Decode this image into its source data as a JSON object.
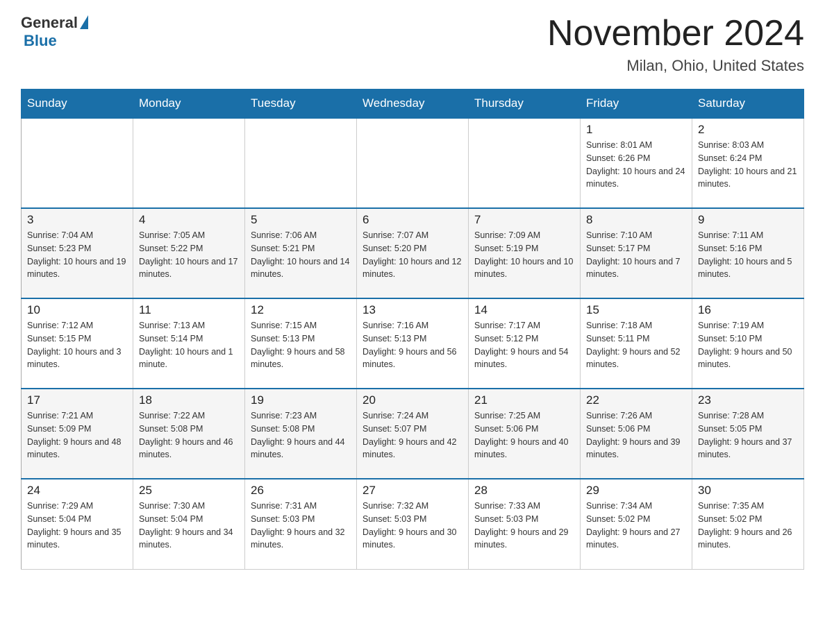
{
  "logo": {
    "general": "General",
    "blue": "Blue"
  },
  "title": "November 2024",
  "location": "Milan, Ohio, United States",
  "weekdays": [
    "Sunday",
    "Monday",
    "Tuesday",
    "Wednesday",
    "Thursday",
    "Friday",
    "Saturday"
  ],
  "weeks": [
    [
      {
        "day": "",
        "info": ""
      },
      {
        "day": "",
        "info": ""
      },
      {
        "day": "",
        "info": ""
      },
      {
        "day": "",
        "info": ""
      },
      {
        "day": "",
        "info": ""
      },
      {
        "day": "1",
        "info": "Sunrise: 8:01 AM\nSunset: 6:26 PM\nDaylight: 10 hours and 24 minutes."
      },
      {
        "day": "2",
        "info": "Sunrise: 8:03 AM\nSunset: 6:24 PM\nDaylight: 10 hours and 21 minutes."
      }
    ],
    [
      {
        "day": "3",
        "info": "Sunrise: 7:04 AM\nSunset: 5:23 PM\nDaylight: 10 hours and 19 minutes."
      },
      {
        "day": "4",
        "info": "Sunrise: 7:05 AM\nSunset: 5:22 PM\nDaylight: 10 hours and 17 minutes."
      },
      {
        "day": "5",
        "info": "Sunrise: 7:06 AM\nSunset: 5:21 PM\nDaylight: 10 hours and 14 minutes."
      },
      {
        "day": "6",
        "info": "Sunrise: 7:07 AM\nSunset: 5:20 PM\nDaylight: 10 hours and 12 minutes."
      },
      {
        "day": "7",
        "info": "Sunrise: 7:09 AM\nSunset: 5:19 PM\nDaylight: 10 hours and 10 minutes."
      },
      {
        "day": "8",
        "info": "Sunrise: 7:10 AM\nSunset: 5:17 PM\nDaylight: 10 hours and 7 minutes."
      },
      {
        "day": "9",
        "info": "Sunrise: 7:11 AM\nSunset: 5:16 PM\nDaylight: 10 hours and 5 minutes."
      }
    ],
    [
      {
        "day": "10",
        "info": "Sunrise: 7:12 AM\nSunset: 5:15 PM\nDaylight: 10 hours and 3 minutes."
      },
      {
        "day": "11",
        "info": "Sunrise: 7:13 AM\nSunset: 5:14 PM\nDaylight: 10 hours and 1 minute."
      },
      {
        "day": "12",
        "info": "Sunrise: 7:15 AM\nSunset: 5:13 PM\nDaylight: 9 hours and 58 minutes."
      },
      {
        "day": "13",
        "info": "Sunrise: 7:16 AM\nSunset: 5:13 PM\nDaylight: 9 hours and 56 minutes."
      },
      {
        "day": "14",
        "info": "Sunrise: 7:17 AM\nSunset: 5:12 PM\nDaylight: 9 hours and 54 minutes."
      },
      {
        "day": "15",
        "info": "Sunrise: 7:18 AM\nSunset: 5:11 PM\nDaylight: 9 hours and 52 minutes."
      },
      {
        "day": "16",
        "info": "Sunrise: 7:19 AM\nSunset: 5:10 PM\nDaylight: 9 hours and 50 minutes."
      }
    ],
    [
      {
        "day": "17",
        "info": "Sunrise: 7:21 AM\nSunset: 5:09 PM\nDaylight: 9 hours and 48 minutes."
      },
      {
        "day": "18",
        "info": "Sunrise: 7:22 AM\nSunset: 5:08 PM\nDaylight: 9 hours and 46 minutes."
      },
      {
        "day": "19",
        "info": "Sunrise: 7:23 AM\nSunset: 5:08 PM\nDaylight: 9 hours and 44 minutes."
      },
      {
        "day": "20",
        "info": "Sunrise: 7:24 AM\nSunset: 5:07 PM\nDaylight: 9 hours and 42 minutes."
      },
      {
        "day": "21",
        "info": "Sunrise: 7:25 AM\nSunset: 5:06 PM\nDaylight: 9 hours and 40 minutes."
      },
      {
        "day": "22",
        "info": "Sunrise: 7:26 AM\nSunset: 5:06 PM\nDaylight: 9 hours and 39 minutes."
      },
      {
        "day": "23",
        "info": "Sunrise: 7:28 AM\nSunset: 5:05 PM\nDaylight: 9 hours and 37 minutes."
      }
    ],
    [
      {
        "day": "24",
        "info": "Sunrise: 7:29 AM\nSunset: 5:04 PM\nDaylight: 9 hours and 35 minutes."
      },
      {
        "day": "25",
        "info": "Sunrise: 7:30 AM\nSunset: 5:04 PM\nDaylight: 9 hours and 34 minutes."
      },
      {
        "day": "26",
        "info": "Sunrise: 7:31 AM\nSunset: 5:03 PM\nDaylight: 9 hours and 32 minutes."
      },
      {
        "day": "27",
        "info": "Sunrise: 7:32 AM\nSunset: 5:03 PM\nDaylight: 9 hours and 30 minutes."
      },
      {
        "day": "28",
        "info": "Sunrise: 7:33 AM\nSunset: 5:03 PM\nDaylight: 9 hours and 29 minutes."
      },
      {
        "day": "29",
        "info": "Sunrise: 7:34 AM\nSunset: 5:02 PM\nDaylight: 9 hours and 27 minutes."
      },
      {
        "day": "30",
        "info": "Sunrise: 7:35 AM\nSunset: 5:02 PM\nDaylight: 9 hours and 26 minutes."
      }
    ]
  ]
}
